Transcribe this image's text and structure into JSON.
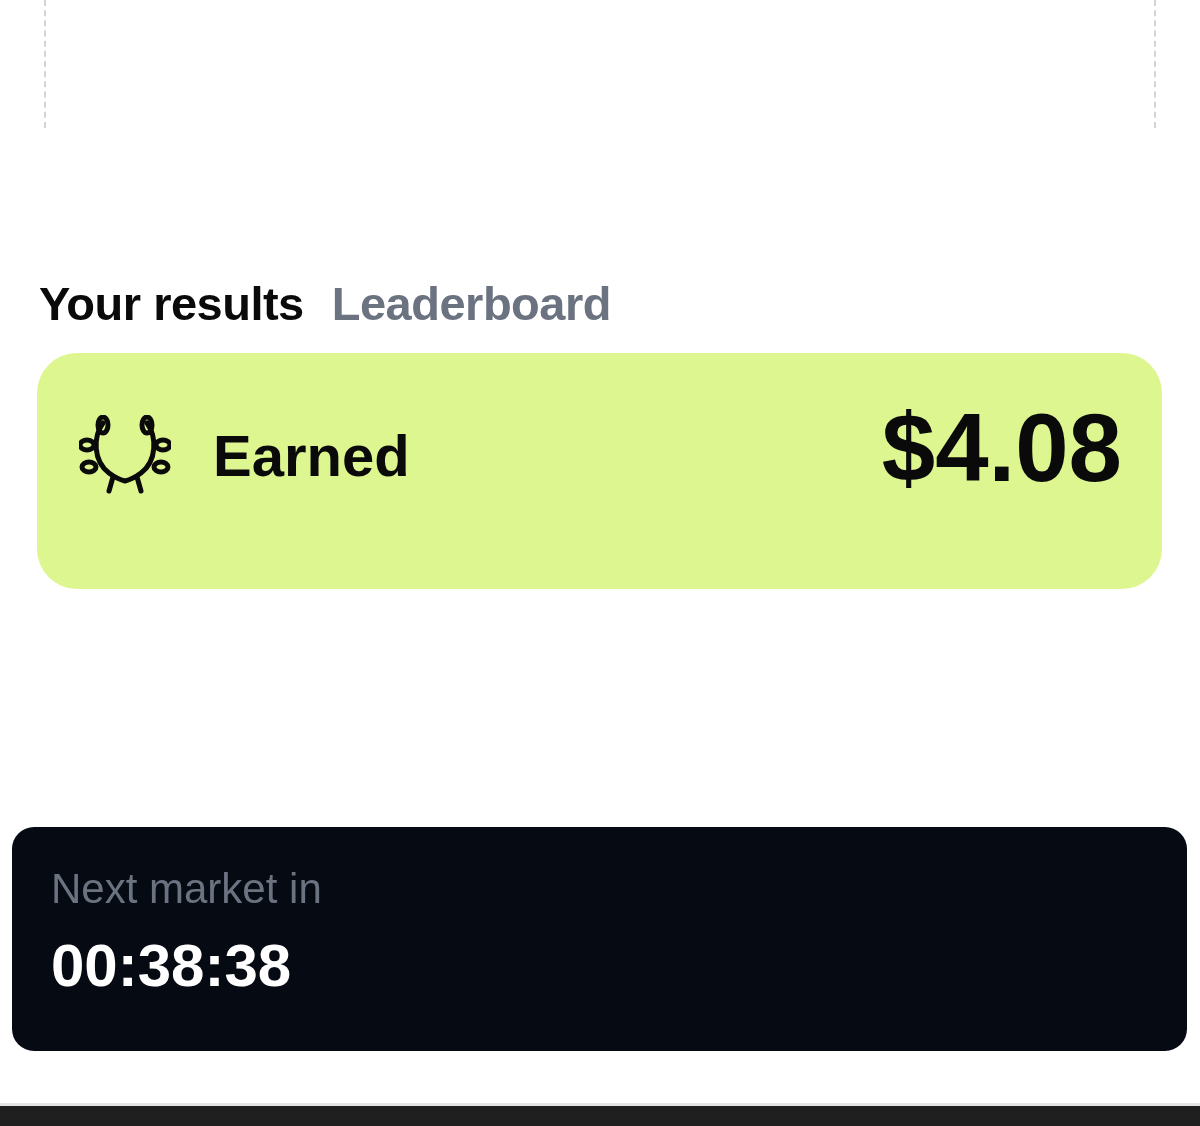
{
  "tabs": [
    {
      "label": "Your results",
      "selected": true
    },
    {
      "label": "Leaderboard",
      "selected": false
    }
  ],
  "earned_card": {
    "label": "Earned",
    "amount": "$4.08"
  },
  "countdown": {
    "label": "Next market in",
    "time": "00:38:38"
  }
}
